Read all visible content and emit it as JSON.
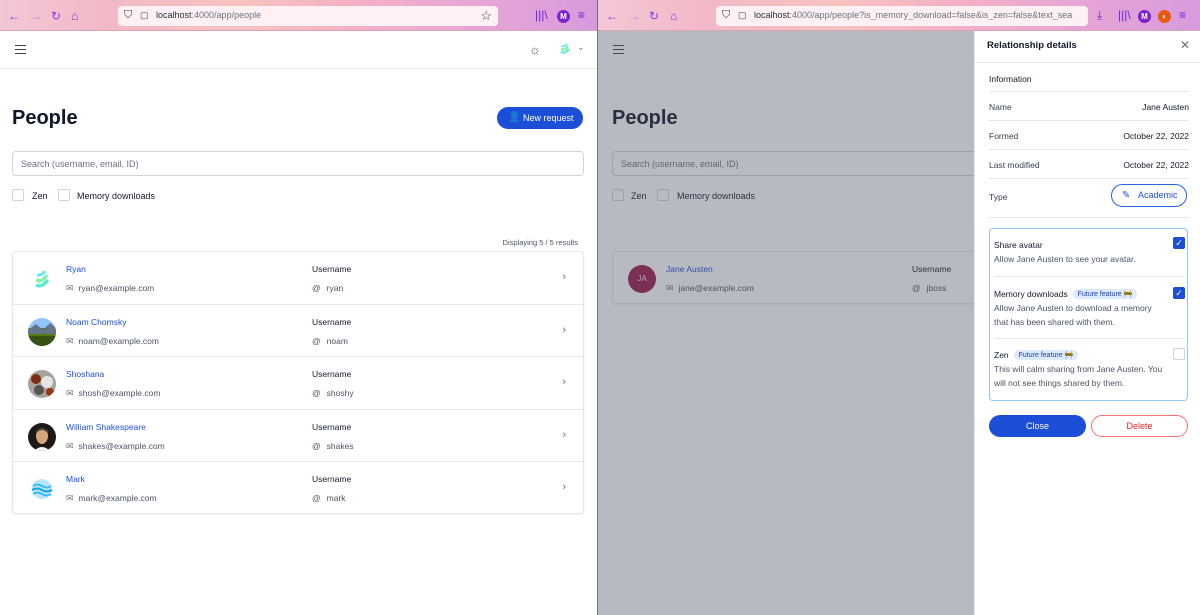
{
  "left_window": {
    "url_host": "localhost",
    "url_rest": ":4000/app/people",
    "page": {
      "title": "People",
      "new_request_label": "New request",
      "search_placeholder": "Search (username, email, ID)",
      "filters": [
        {
          "label": "Zen",
          "checked": false
        },
        {
          "label": "Memory downloads",
          "checked": false
        }
      ],
      "displaying": "Displaying 5 / 5 results",
      "username_header": "Username",
      "people": [
        {
          "name": "Ryan",
          "email": "ryan@example.com",
          "username": "ryan",
          "avatar": "logo-swirl"
        },
        {
          "name": "Noam Chomsky",
          "email": "noam@example.com",
          "username": "noam",
          "avatar": "photo-landscape"
        },
        {
          "name": "Shoshana",
          "email": "shosh@example.com",
          "username": "shoshy",
          "avatar": "photo-stones"
        },
        {
          "name": "William Shakespeare",
          "email": "shakes@example.com",
          "username": "shakes",
          "avatar": "photo-portrait"
        },
        {
          "name": "Mark",
          "email": "mark@example.com",
          "username": "mark",
          "avatar": "logo-waves"
        }
      ]
    }
  },
  "right_window": {
    "url_host": "localhost",
    "url_rest": ":4000/app/people?is_memory_download=false&is_zen=false&text_sea",
    "page": {
      "title": "People",
      "search_placeholder": "Search (username, email, ID)",
      "filters": [
        {
          "label": "Zen",
          "checked": false
        },
        {
          "label": "Memory downloads",
          "checked": false
        }
      ],
      "username_header": "Username",
      "person": {
        "initials": "JA",
        "name": "Jane Austen",
        "email": "jane@example.com",
        "username": "jboss",
        "avatar_color": "#9d174d"
      }
    },
    "panel": {
      "title": "Relationship details",
      "section": "Information",
      "fields": [
        {
          "key": "Name",
          "value": "Jane Austen"
        },
        {
          "key": "Formed",
          "value": "October 22, 2022"
        },
        {
          "key": "Last modified",
          "value": "October 22, 2022"
        },
        {
          "key": "Type",
          "value": "Academic"
        }
      ],
      "permissions": [
        {
          "title": "Share avatar",
          "desc": "Allow Jane Austen to see your avatar.",
          "badge": "",
          "checked": true
        },
        {
          "title": "Memory downloads",
          "desc": "Allow Jane Austen to download a memory that has been shared with them.",
          "badge": "Future feature 🚧",
          "checked": true
        },
        {
          "title": "Zen",
          "desc": "This will calm sharing from Jane Austen. You will not see things shared by them.",
          "badge": "Future feature 🚧",
          "checked": false
        }
      ],
      "close_label": "Close",
      "delete_label": "Delete"
    }
  },
  "colors": {
    "primary": "#1d4ed8",
    "danger": "#dc2626",
    "link": "#1d4ed8"
  }
}
